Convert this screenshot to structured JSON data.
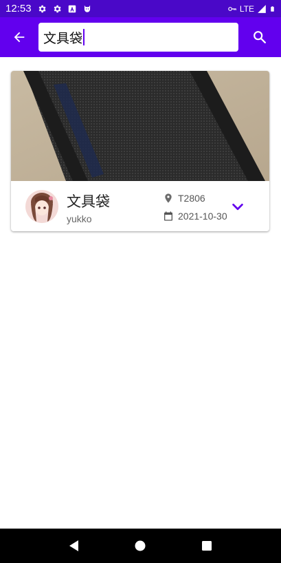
{
  "status_bar": {
    "time": "12:53",
    "network": "LTE",
    "icons": [
      "gear-icon",
      "gear-icon",
      "a-box-icon",
      "cat-icon",
      "key-icon",
      "signal-icon",
      "battery-icon"
    ]
  },
  "app_bar": {
    "search_value": "文具袋",
    "back_icon": "arrow-back-icon",
    "search_icon": "search-icon",
    "color": "#6200ee"
  },
  "results": [
    {
      "title": "文具袋",
      "user": "yukko",
      "location": "T2806",
      "date": "2021-10-30"
    }
  ],
  "nav_bar": {
    "icons": [
      "back-triangle-icon",
      "home-circle-icon",
      "recents-square-icon"
    ]
  }
}
